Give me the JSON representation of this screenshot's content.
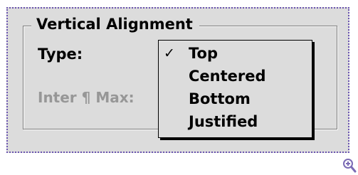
{
  "group": {
    "title": "Vertical Alignment"
  },
  "labels": {
    "type": "Type:",
    "inter": "Inter ¶ Max:"
  },
  "menu": {
    "selected": "Top",
    "check_glyph": "✓",
    "items": [
      {
        "label": "Top",
        "checked": true
      },
      {
        "label": "Centered",
        "checked": false
      },
      {
        "label": "Bottom",
        "checked": false
      },
      {
        "label": "Justified",
        "checked": false
      }
    ]
  },
  "colors": {
    "selection_frame": "#6b55b0",
    "panel_background": "#dcdcdc",
    "disabled_text": "#979797",
    "zoom_icon": "#7b6bb5"
  },
  "icons": {
    "zoom": "zoom-in-icon"
  }
}
